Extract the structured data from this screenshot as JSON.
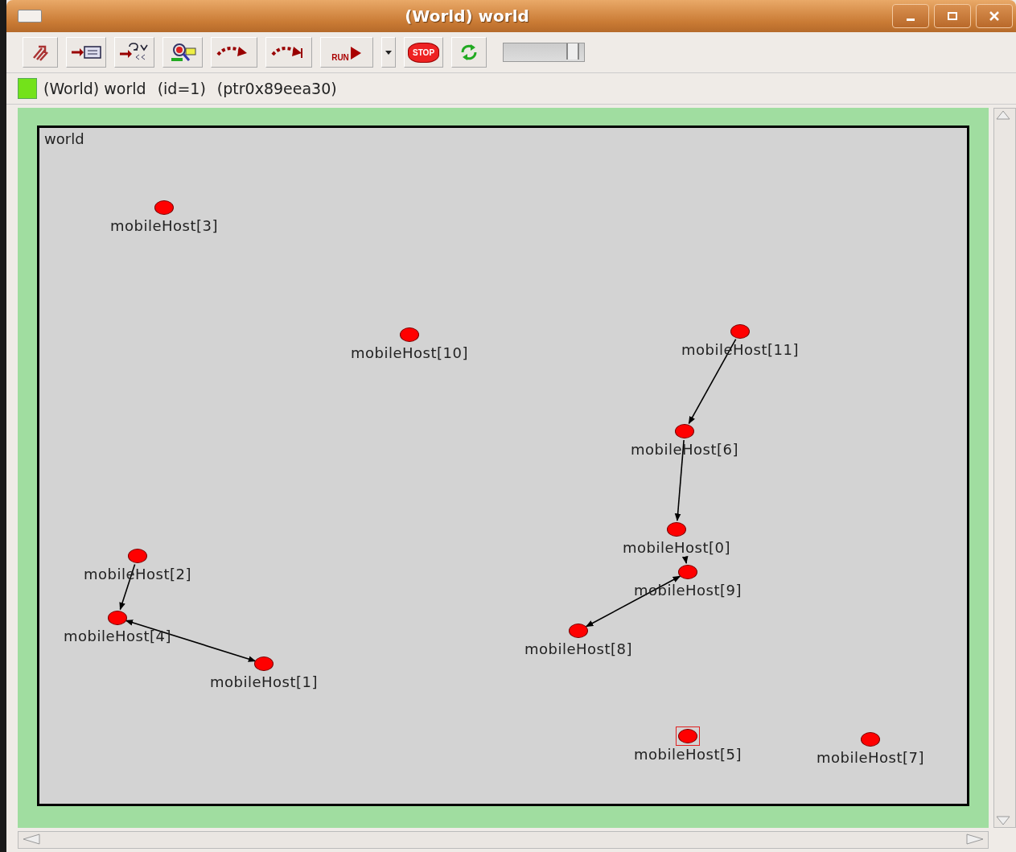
{
  "window": {
    "title": "(World) world"
  },
  "toolbar": [
    {
      "kind": "parent"
    },
    {
      "kind": "inspect"
    },
    {
      "kind": "events"
    },
    {
      "kind": "find"
    },
    {
      "kind": "step"
    },
    {
      "kind": "fast"
    },
    {
      "kind": "run",
      "label": "RUN"
    },
    {
      "kind": "dropdown"
    },
    {
      "kind": "stop",
      "label": "STOP"
    },
    {
      "kind": "refresh"
    },
    {
      "kind": "slider",
      "level": 0.9
    }
  ],
  "status": {
    "name": "(World) world",
    "id": "(id=1)",
    "ptr": "(ptr0x89eea30)"
  },
  "canvas": {
    "title": "world",
    "nodes": [
      {
        "label": "mobileHost[3]",
        "selected": false
      },
      {
        "label": "mobileHost[10]",
        "selected": false
      },
      {
        "label": "mobileHost[11]",
        "selected": false
      },
      {
        "label": "mobileHost[6]",
        "selected": false
      },
      {
        "label": "mobileHost[0]",
        "selected": false
      },
      {
        "label": "mobileHost[9]",
        "selected": false
      },
      {
        "label": "mobileHost[2]",
        "selected": false
      },
      {
        "label": "mobileHost[4]",
        "selected": false
      },
      {
        "label": "mobileHost[8]",
        "selected": false
      },
      {
        "label": "mobileHost[1]",
        "selected": false
      },
      {
        "label": "mobileHost[5]",
        "selected": true
      },
      {
        "label": "mobileHost[7]",
        "selected": false
      }
    ]
  }
}
